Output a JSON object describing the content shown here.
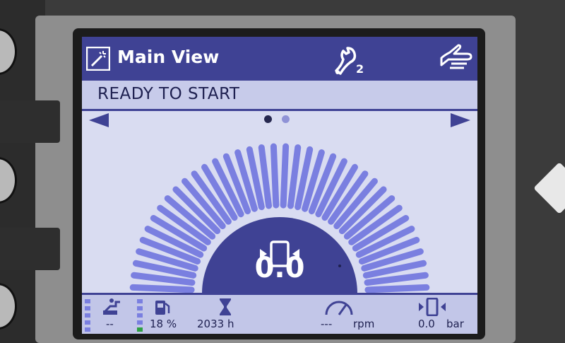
{
  "header": {
    "title": "Main View",
    "maintenance_level": "2"
  },
  "status": {
    "text": "READY TO START"
  },
  "gauge": {
    "value": "0.0",
    "level": 0
  },
  "bottom": {
    "fuel_flow_value": "--",
    "fuel_level_value": "18 %",
    "fuel_level_fraction": 0.18,
    "hours_value": "2033 h",
    "rpm_value": "---",
    "rpm_unit": "rpm",
    "pressure_value": "0.0",
    "pressure_unit": "bar"
  },
  "colors": {
    "header_bg": "#3f4294",
    "gauge_tick": "#7a7fe0",
    "screen_bg": "#d9dcf1",
    "text_dark": "#1e2050"
  },
  "icons": {
    "title": "settings-wand-icon",
    "maintenance": "wrench-icon",
    "manual_mode": "hand-icon",
    "gauge": "compressor-icon",
    "fuel_flow": "fuel-pump-icon",
    "fuel_level": "fuel-can-icon",
    "hours": "hourglass-icon",
    "rpm": "speedometer-icon",
    "pressure": "compressor-pressure-icon"
  }
}
